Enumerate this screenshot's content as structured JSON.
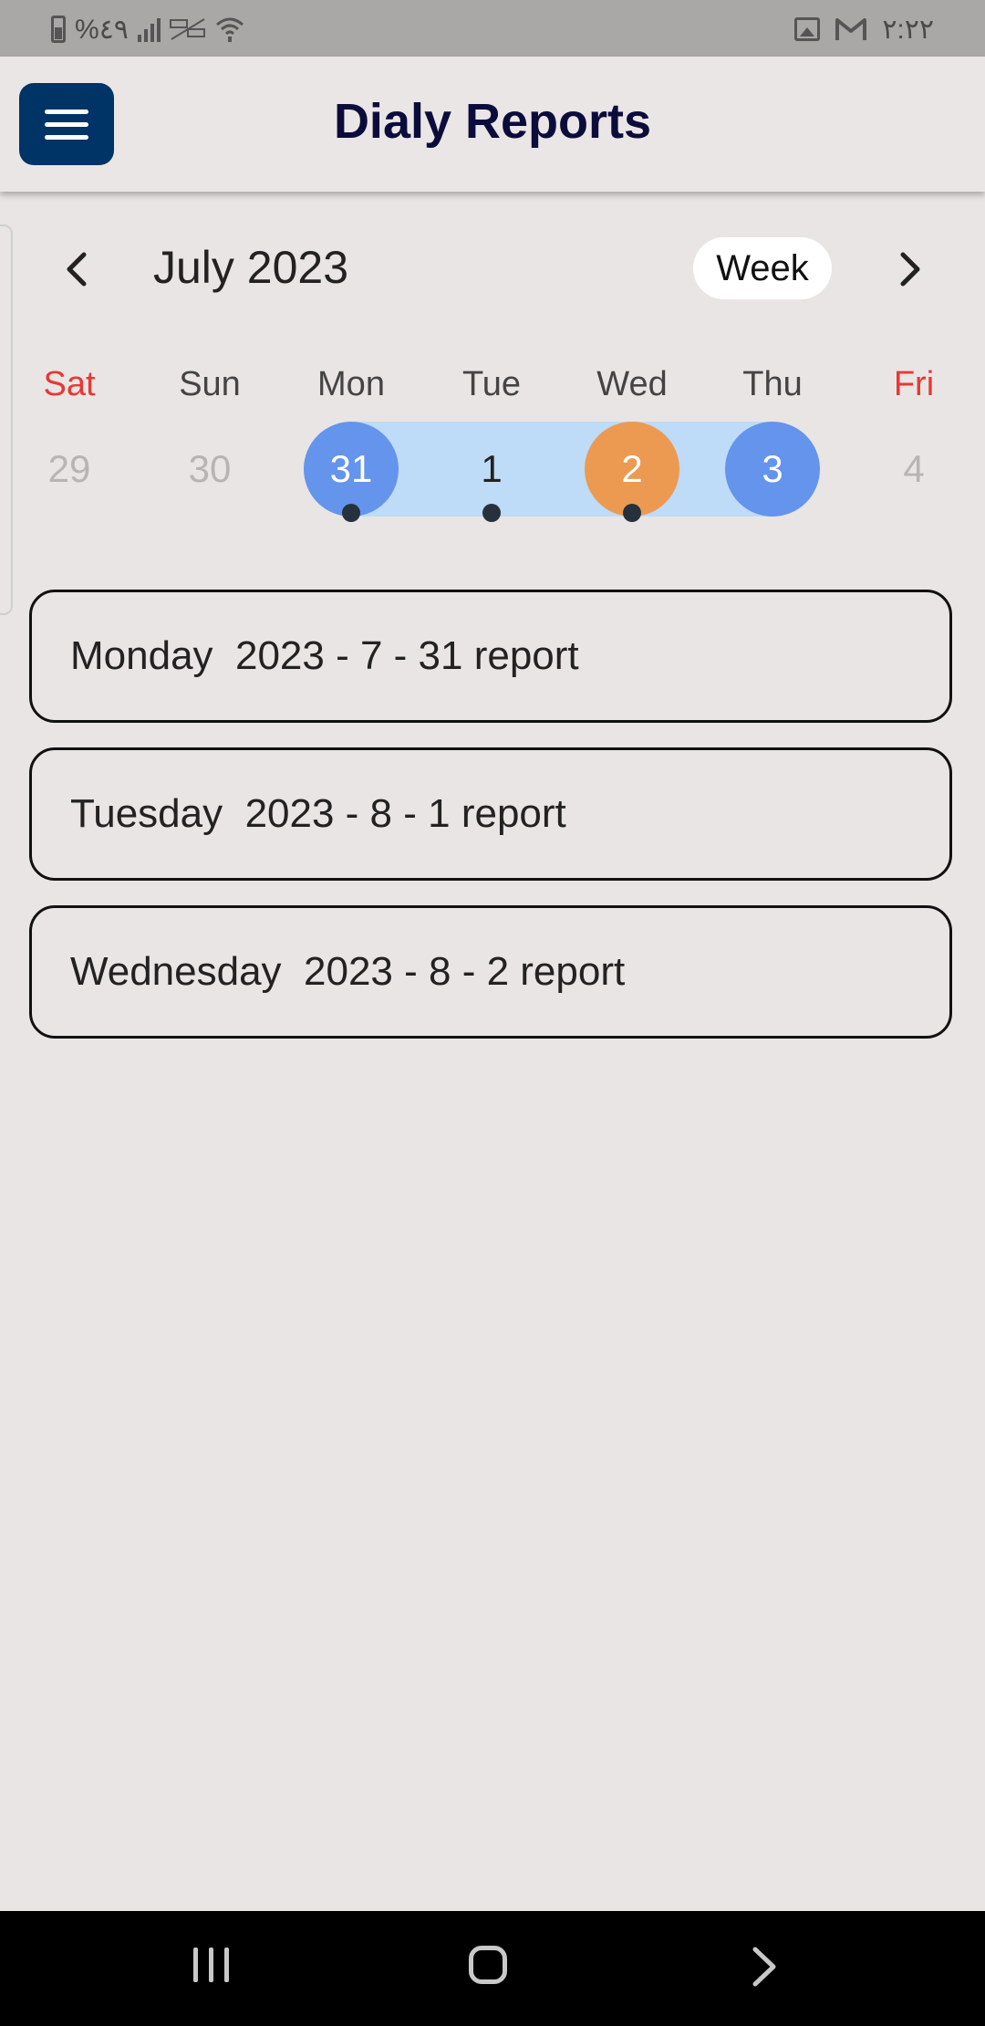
{
  "status_bar": {
    "battery_percent": "%٤٩",
    "time": "٢:٢٢",
    "icons": [
      "battery-icon",
      "signal-icon",
      "data-off-icon",
      "wifi-icon",
      "image-icon",
      "gmail-icon"
    ]
  },
  "app_bar": {
    "title": "Dialy Reports",
    "menu_icon": "hamburger-menu-icon",
    "accent_color": "#003366"
  },
  "calendar": {
    "month_label": "July 2023",
    "view_mode": "Week",
    "weekdays": [
      "Sat",
      "Sun",
      "Mon",
      "Tue",
      "Wed",
      "Thu",
      "Fri"
    ],
    "weekend_days": [
      "Sat",
      "Fri"
    ],
    "days": [
      {
        "label": "29",
        "state": "outside"
      },
      {
        "label": "30",
        "state": "outside"
      },
      {
        "label": "31",
        "state": "range-start",
        "has_event": true
      },
      {
        "label": "1",
        "state": "in-range",
        "has_event": true
      },
      {
        "label": "2",
        "state": "today",
        "has_event": true
      },
      {
        "label": "3",
        "state": "range-end",
        "has_event": false
      },
      {
        "label": "4",
        "state": "outside"
      }
    ],
    "colors": {
      "range_band": "#bedbf7",
      "range_endpoint": "#6494ec",
      "today": "#ec9a52",
      "weekend": "#e53935"
    }
  },
  "reports": [
    {
      "label": "Monday  2023 - 7 - 31 report"
    },
    {
      "label": "Tuesday  2023 - 8 - 1 report"
    },
    {
      "label": "Wednesday  2023 - 8 - 2 report"
    }
  ],
  "nav_bar": {
    "icons": [
      "recent-apps-icon",
      "home-icon",
      "back-icon"
    ]
  }
}
